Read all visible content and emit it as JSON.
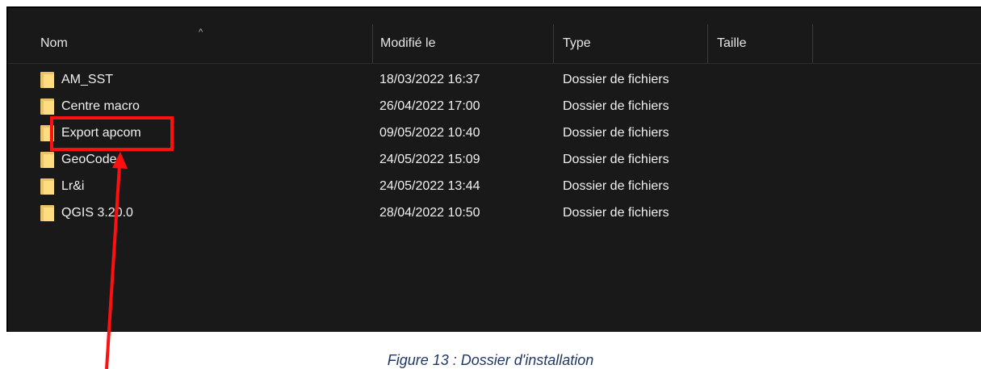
{
  "columns": {
    "name": "Nom",
    "modified": "Modifié le",
    "type": "Type",
    "size": "Taille"
  },
  "sort_indicator": "^",
  "rows": [
    {
      "name": "AM_SST",
      "modified": "18/03/2022 16:37",
      "type": "Dossier de fichiers"
    },
    {
      "name": "Centre macro",
      "modified": "26/04/2022 17:00",
      "type": "Dossier de fichiers"
    },
    {
      "name": "Export apcom",
      "modified": "09/05/2022 10:40",
      "type": "Dossier de fichiers"
    },
    {
      "name": "GeoCode",
      "modified": "24/05/2022 15:09",
      "type": "Dossier de fichiers"
    },
    {
      "name": "Lr&i",
      "modified": "24/05/2022 13:44",
      "type": "Dossier de fichiers"
    },
    {
      "name": "QGIS 3.20.0",
      "modified": "28/04/2022 10:50",
      "type": "Dossier de fichiers"
    }
  ],
  "caption": "Figure 13 : Dossier d'installation",
  "colors": {
    "background": "#191919",
    "text": "#f0f0f0",
    "highlight": "#ff1010",
    "folder": "#ffdc82",
    "caption": "#1f3864"
  }
}
